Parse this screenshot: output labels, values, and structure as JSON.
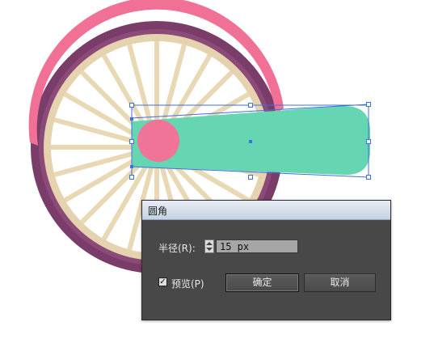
{
  "colors": {
    "tire_pink": "#f07096",
    "tire_pink_dark": "#d8356a",
    "tire_purple": "#7a3c69",
    "rim": "#e8d8b4",
    "spoke": "#e8d8b4",
    "pedal_arm": "#66d6b2",
    "hub": "#f07398",
    "selection": "#3d6fe0",
    "dialog_bg": "#484848"
  },
  "dialog": {
    "title": "圆角",
    "radius_label": "半径(R):",
    "radius_value": "15 px",
    "preview_label": "预览(P)",
    "preview_checked": "✓",
    "ok_label": "确定",
    "cancel_label": "取消"
  }
}
